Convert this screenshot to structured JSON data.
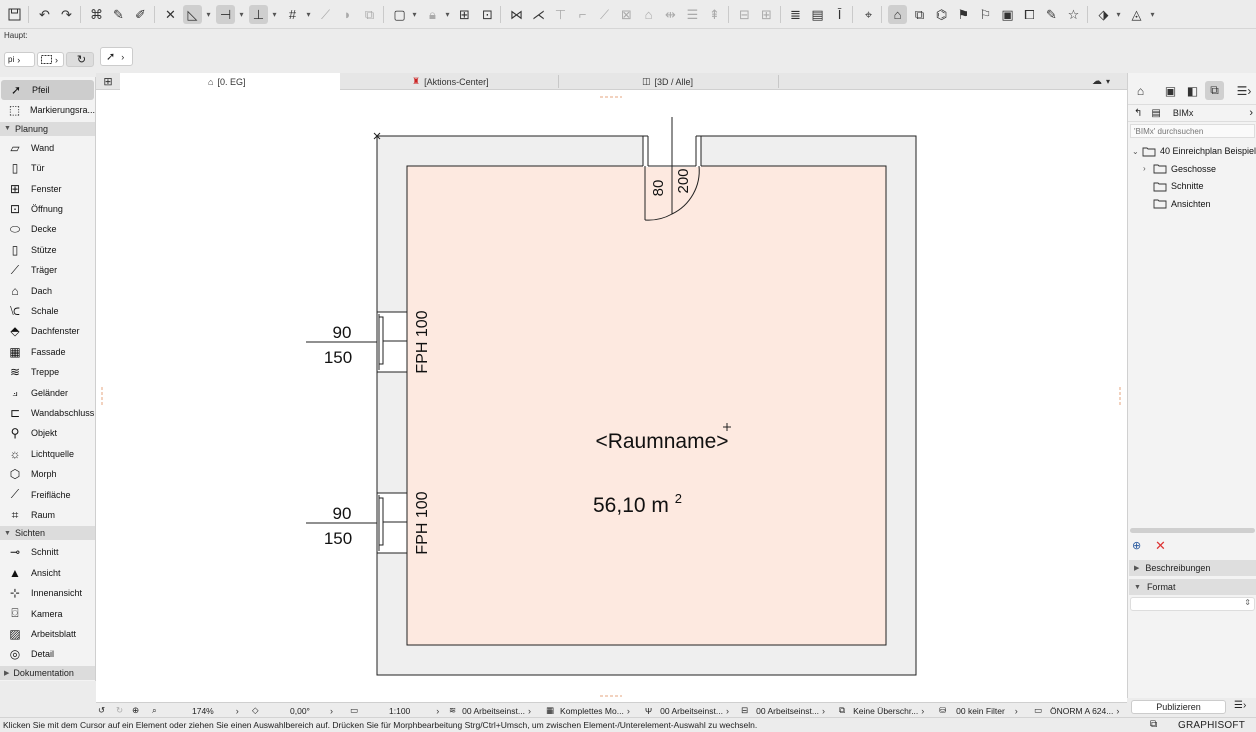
{
  "toolbar": {
    "haupt_label": "Haupt:"
  },
  "info_strip": {
    "layer_short": "pi"
  },
  "toolbox": {
    "tools_top": [
      {
        "label": "Pfeil",
        "icon": "arrow-pointer-icon",
        "selected": true
      },
      {
        "label": "Markierungsra...",
        "icon": "marquee-icon",
        "selected": false
      }
    ],
    "groups": [
      {
        "name": "Planung",
        "items": [
          {
            "label": "Wand",
            "icon": "wall-icon"
          },
          {
            "label": "Tür",
            "icon": "door-icon"
          },
          {
            "label": "Fenster",
            "icon": "window-icon"
          },
          {
            "label": "Öffnung",
            "icon": "opening-icon"
          },
          {
            "label": "Decke",
            "icon": "slab-icon"
          },
          {
            "label": "Stütze",
            "icon": "column-icon"
          },
          {
            "label": "Träger",
            "icon": "beam-icon"
          },
          {
            "label": "Dach",
            "icon": "roof-icon"
          },
          {
            "label": "Schale",
            "icon": "shell-icon"
          },
          {
            "label": "Dachfenster",
            "icon": "skylight-icon"
          },
          {
            "label": "Fassade",
            "icon": "curtain-wall-icon"
          },
          {
            "label": "Treppe",
            "icon": "stair-icon"
          },
          {
            "label": "Geländer",
            "icon": "railing-icon"
          },
          {
            "label": "Wandabschluss",
            "icon": "wall-end-icon"
          },
          {
            "label": "Objekt",
            "icon": "object-icon"
          },
          {
            "label": "Lichtquelle",
            "icon": "lamp-icon"
          },
          {
            "label": "Morph",
            "icon": "morph-icon"
          },
          {
            "label": "Freifläche",
            "icon": "mesh-icon"
          },
          {
            "label": "Raum",
            "icon": "zone-icon"
          }
        ]
      },
      {
        "name": "Sichten",
        "items": [
          {
            "label": "Schnitt",
            "icon": "section-icon"
          },
          {
            "label": "Ansicht",
            "icon": "elevation-icon"
          },
          {
            "label": "Innenansicht",
            "icon": "interior-elevation-icon"
          },
          {
            "label": "Kamera",
            "icon": "camera-icon"
          },
          {
            "label": "Arbeitsblatt",
            "icon": "worksheet-icon"
          },
          {
            "label": "Detail",
            "icon": "detail-icon"
          }
        ]
      },
      {
        "name": "Dokumentation",
        "items": []
      }
    ]
  },
  "tabs": [
    {
      "label": "[0. EG]",
      "icon": "floor-plan-icon",
      "active": true
    },
    {
      "label": "[Aktions-Center]",
      "icon": "action-center-icon",
      "active": false
    },
    {
      "label": "[3D / Alle]",
      "icon": "3d-window-icon",
      "active": false
    }
  ],
  "drawing": {
    "room_name": "<Raumname>",
    "room_area": "56,10 m",
    "room_area_sup": "2",
    "door_width": "80",
    "door_height": "200",
    "window_1": {
      "parapet": "90",
      "height": "150",
      "label": "FPH 100"
    },
    "window_2": {
      "parapet": "90",
      "height": "150",
      "label": "FPH 100"
    },
    "colors": {
      "room_fill": "#fde9e0",
      "wall_fill": "#efefef",
      "line": "#222222"
    }
  },
  "navigator": {
    "source_label": "BIMx",
    "search_placeholder": "'BIMx' durchsuchen",
    "tree": [
      {
        "label": "40 Einreichplan Beispiel",
        "level": 0,
        "expanded": true
      },
      {
        "label": "Geschosse",
        "level": 1,
        "expanded": false
      },
      {
        "label": "Schnitte",
        "level": 1,
        "expanded": false
      },
      {
        "label": "Ansichten",
        "level": 1,
        "expanded": false
      }
    ],
    "sections": [
      {
        "label": "Beschreibungen",
        "expanded": false
      },
      {
        "label": "Format",
        "expanded": true
      }
    ],
    "publish_label": "Publizieren"
  },
  "statusbar": {
    "zoom": "174%",
    "angle": "0,00°",
    "scale": "1:100",
    "layer_combo": "00 Arbeitseinst...",
    "structure": "Komplettes Mo...",
    "pen_set": "00 Arbeitseinst...",
    "mvo": "00 Arbeitseinst...",
    "override": "Keine Überschr...",
    "renovation": "00 kein Filter",
    "dimension": "ÖNORM A 624..."
  },
  "message": "Klicken Sie mit dem Cursor auf ein Element oder ziehen Sie einen Auswahlbereich auf. Drücken Sie für Morphbearbeitung Strg/Ctrl+Umsch, um zwischen Element-/Unterelement-Auswahl zu wechseln.",
  "brand": "GRAPHISOFT ID"
}
